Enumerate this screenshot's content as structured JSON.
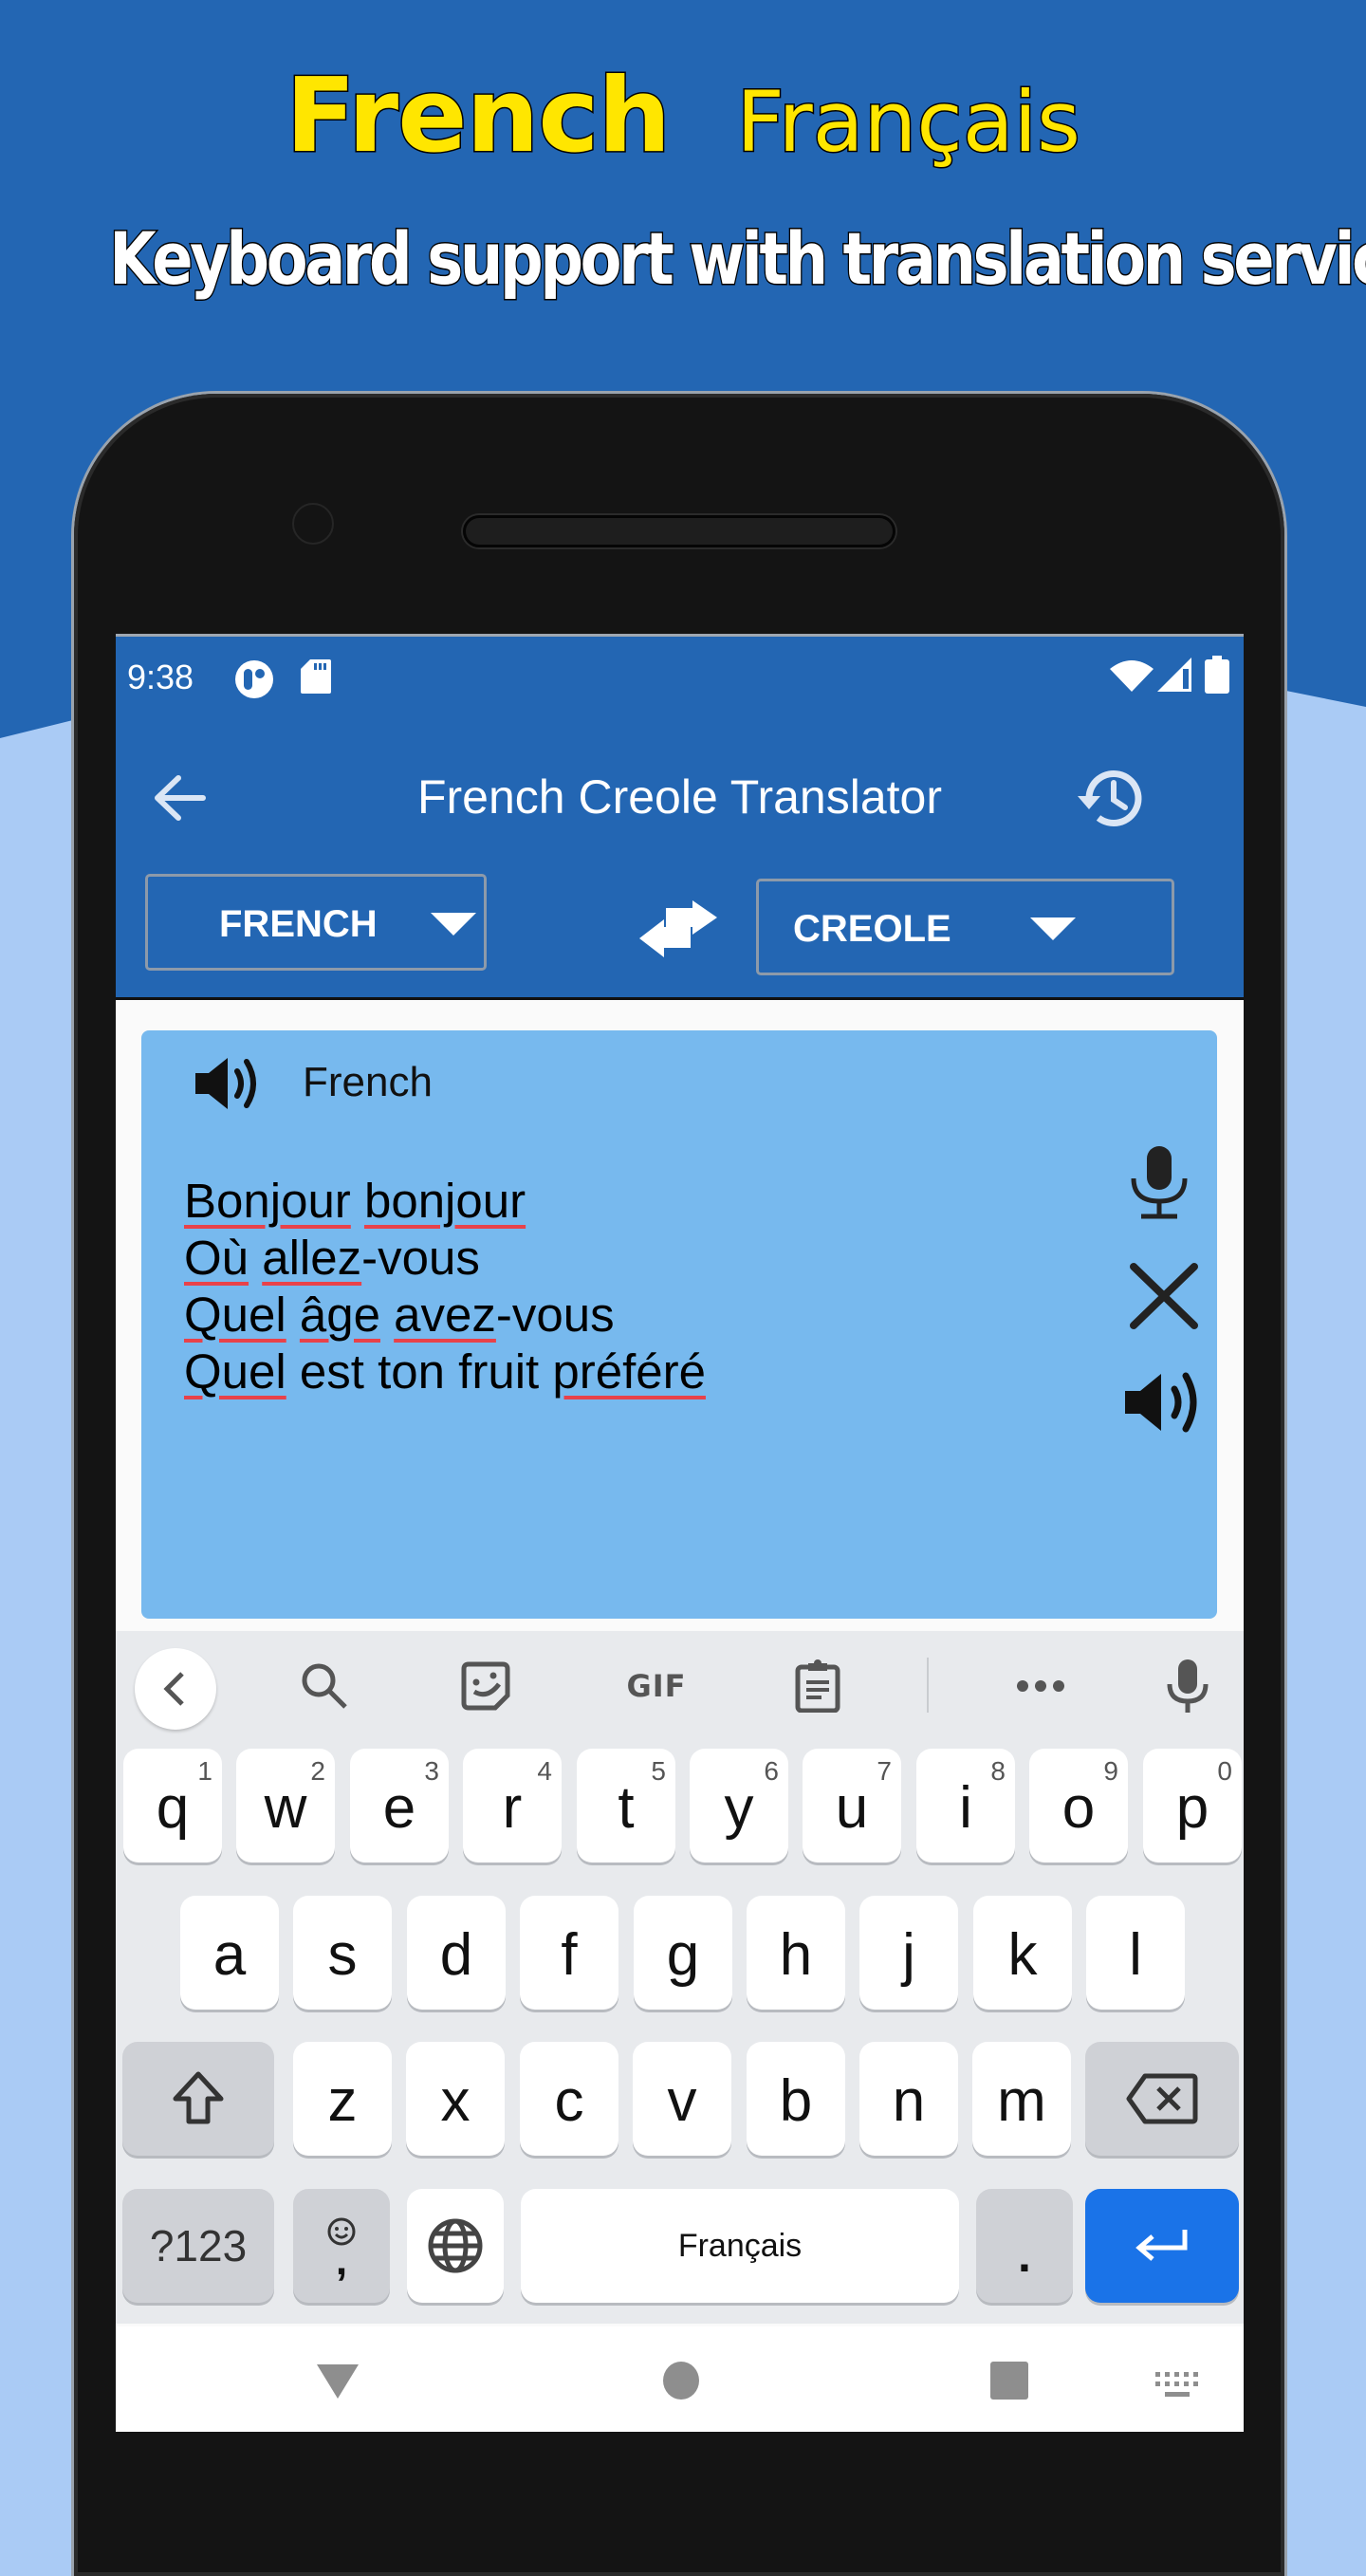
{
  "promo": {
    "title_en": "French",
    "title_native": "Français",
    "subtitle": "Keyboard support with translation service"
  },
  "colors": {
    "background_dark": "#2366b3",
    "background_light": "#aacbf5",
    "title_yellow": "#ffe600",
    "appbar": "#2366b3",
    "card": "#77b9ee",
    "spellcheck_underline": "#e8424a",
    "enter_key": "#1a73e8"
  },
  "status_bar": {
    "time": "9:38",
    "left_icons": [
      "notification-app-icon",
      "sd-card-icon"
    ],
    "right_icons": [
      "wifi-icon",
      "signal-icon",
      "battery-icon"
    ]
  },
  "toolbar": {
    "title": "French Creole Translator",
    "back_icon": "arrow-left-icon",
    "history_icon": "history-icon"
  },
  "language_selector": {
    "source": "FRENCH",
    "target": "CREOLE",
    "swap_icon": "swap-arrows-icon"
  },
  "input_card": {
    "language_label": "French",
    "lines": [
      [
        {
          "t": "Bonjour",
          "sp": true
        },
        {
          "t": " "
        },
        {
          "t": "bonjour",
          "sp": true
        }
      ],
      [
        {
          "t": "Où",
          "sp": true
        },
        {
          "t": " "
        },
        {
          "t": "allez",
          "sp": true
        },
        {
          "t": "-vous"
        }
      ],
      [
        {
          "t": "Quel",
          "sp": true
        },
        {
          "t": " "
        },
        {
          "t": "âge",
          "sp": true
        },
        {
          "t": " "
        },
        {
          "t": "avez",
          "sp": true
        },
        {
          "t": "-vous"
        }
      ],
      [
        {
          "t": "Quel",
          "sp": true
        },
        {
          "t": " est ton fruit "
        },
        {
          "t": "préféré",
          "sp": true
        }
      ]
    ],
    "actions": [
      "microphone-icon",
      "clear-icon",
      "speaker-icon"
    ]
  },
  "keyboard": {
    "toolbar": {
      "gif_label": "GIF",
      "items": [
        "back-chevron-icon",
        "search-icon",
        "sticker-icon",
        "gif",
        "clipboard-icon",
        "more-icon",
        "voice-input-icon"
      ]
    },
    "row1": [
      {
        "k": "q",
        "h": "1"
      },
      {
        "k": "w",
        "h": "2"
      },
      {
        "k": "e",
        "h": "3"
      },
      {
        "k": "r",
        "h": "4"
      },
      {
        "k": "t",
        "h": "5"
      },
      {
        "k": "y",
        "h": "6"
      },
      {
        "k": "u",
        "h": "7"
      },
      {
        "k": "i",
        "h": "8"
      },
      {
        "k": "o",
        "h": "9"
      },
      {
        "k": "p",
        "h": "0"
      }
    ],
    "row2": [
      "a",
      "s",
      "d",
      "f",
      "g",
      "h",
      "j",
      "k",
      "l"
    ],
    "row3": [
      "z",
      "x",
      "c",
      "v",
      "b",
      "n",
      "m"
    ],
    "symbols_label": "?123",
    "comma_label": ",",
    "space_label": "Français",
    "period_label": "."
  },
  "nav_bar": {
    "items": [
      "back-triangle-icon",
      "home-circle-icon",
      "recents-square-icon",
      "keyboard-switch-icon"
    ]
  }
}
